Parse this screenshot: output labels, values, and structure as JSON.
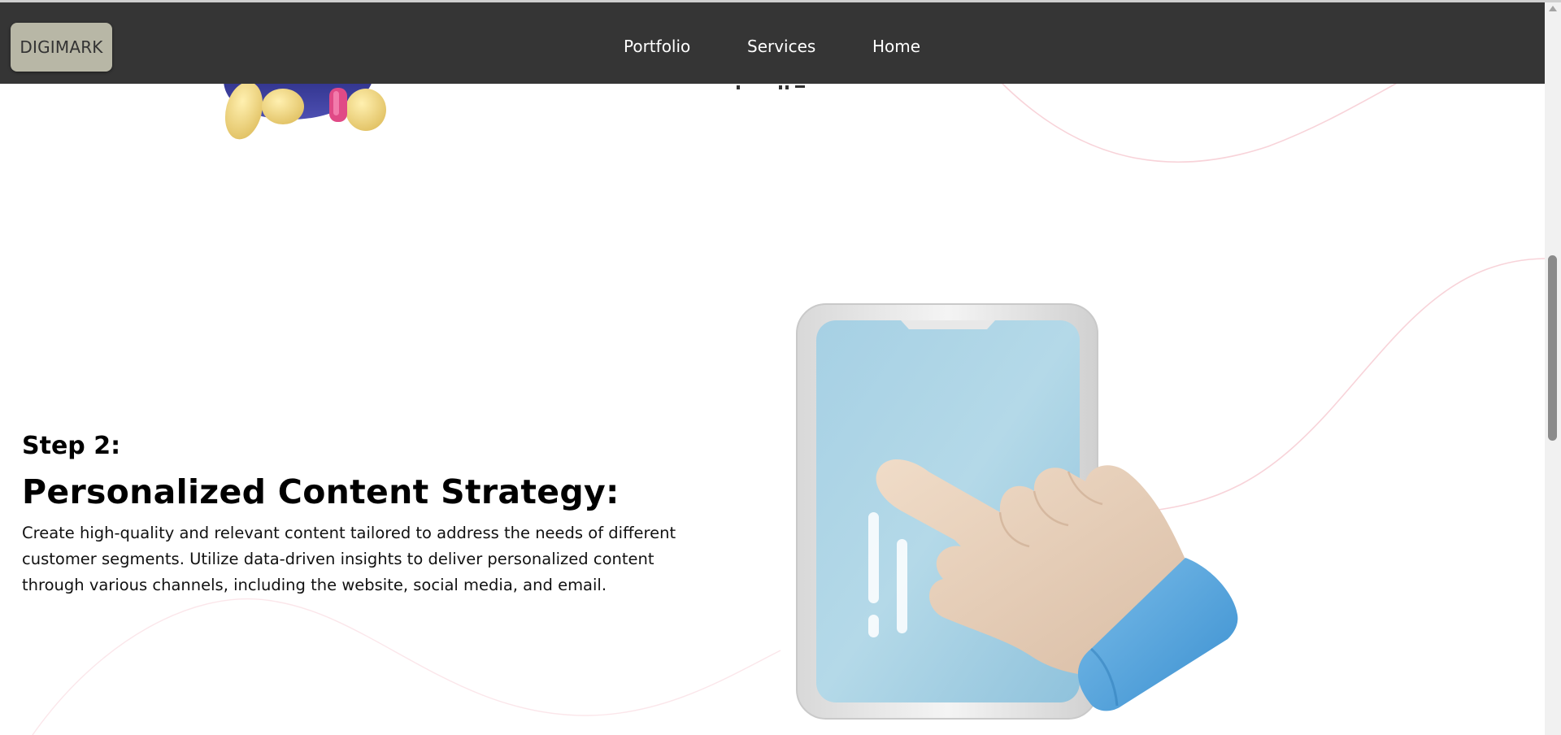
{
  "header": {
    "logo_text": "DIGIMARK",
    "nav": {
      "portfolio": "Portfolio",
      "services": "Services",
      "home": "Home"
    },
    "background": "#353535",
    "logo_background": "#b8b7a6"
  },
  "main": {
    "step_label": "Step 2:",
    "step_title": "Personalized Content Strategy:",
    "step_description": "Create high-quality and relevant content tailored to address the needs of different customer segments. Utilize data-driven insights to deliver personalized content through various channels, including the website, social media, and email."
  },
  "images": {
    "mascot": "3d-mascot-character-image",
    "illustration": "hand-tapping-phone-illustration"
  },
  "colors": {
    "accent_curve": "#f6c8d0",
    "phone_screen": "#a9d3e6",
    "sleeve": "#4ea3dd",
    "hand": "#e6cdb7"
  },
  "icons": {
    "scroll_up": "triangle-up-icon"
  }
}
